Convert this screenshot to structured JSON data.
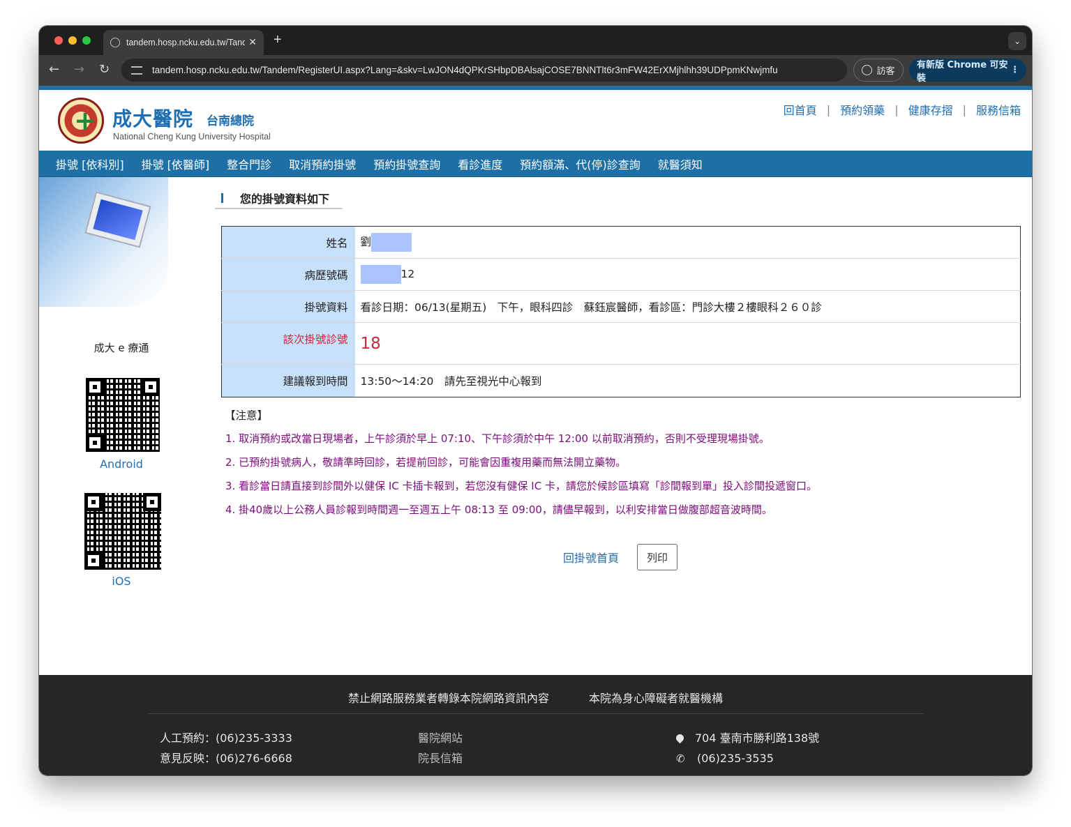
{
  "browser": {
    "tab_title": "tandem.hosp.ncku.edu.tw/Tandem",
    "tab_close": "✕",
    "new_tab": "+",
    "url": "tandem.hosp.ncku.edu.tw/Tandem/RegisterUI.aspx?Lang=&skv=LwJON4dQPKrSHbpDBAlsajCOSE7BNNTlt6r3mFW42ErXMjhlhh39UDPpmKNwjmfu",
    "guest_label": "訪客",
    "update_label": "有新版 Chrome 可安裝"
  },
  "header": {
    "hospital_name": "成大醫院",
    "branch": "台南總院",
    "english_name": "National Cheng Kung University Hospital",
    "top_links": [
      "回首頁",
      "預約領藥",
      "健康存摺",
      "服務信箱"
    ],
    "separator": "|"
  },
  "nav": [
    "掛號 [依科別]",
    "掛號 [依醫師]",
    "整合門診",
    "取消預約掛號",
    "預約掛號查詢",
    "看診進度",
    "預約額滿、代(停)診查詢",
    "就醫須知"
  ],
  "sidebar": {
    "app_title": "成大 e 療通",
    "android_label": "Android",
    "ios_label": "iOS"
  },
  "content": {
    "section_title": "您的掛號資料如下",
    "rows": {
      "name_label": "姓名",
      "name_value": "劉",
      "record_label": "病歷號碼",
      "record_value": "12",
      "reg_label": "掛號資料",
      "reg_value": "看診日期：06/13(星期五)　下午，眼科四診　蘇鈺宸醫師，看診區：門診大樓２樓眼科２６０診",
      "number_label": "該次掛號診號",
      "number_value": "18",
      "time_label": "建議報到時間",
      "time_value": "13:50～14:20　請先至視光中心報到"
    },
    "notes_head": "【注意】",
    "notes": [
      "1. 取消預約或改當日現場者，上午診須於早上 07:10、下午診須於中午 12:00 以前取消預約，否則不受理現場掛號。",
      "2. 已預約掛號病人，敬請準時回診，若提前回診，可能會因重複用藥而無法開立藥物。",
      "3. 看診當日請直接到診間外以健保 IC 卡插卡報到，若您沒有健保 IC 卡，請您於候診區填寫「診間報到單」投入診間投遞窗口。",
      "4. 掛40歲以上公務人員診報到時間週一至週五上午 08:13 至 09:00，請儘早報到，以利安排當日做腹部超音波時間。"
    ],
    "back_link": "回掛號首頁",
    "print_label": "列印"
  },
  "footer": {
    "notice1": "禁止網路服務業者轉錄本院網路資訊內容",
    "notice2": "本院為身心障礙者就醫機構",
    "manual_booking": "人工預約：(06)235-3333",
    "feedback": "意見反映：(06)276-6668",
    "website": "醫院網站",
    "director_mail": "院長信箱",
    "address": "704 臺南市勝利路138號",
    "phone": "(06)235-3535"
  },
  "colors": {
    "nav_blue": "#1d6fa5",
    "label_bg": "#c8e1fb",
    "alert_red": "#c9273a",
    "note_purple": "#7a0d7a",
    "footer_bg": "#262626"
  }
}
